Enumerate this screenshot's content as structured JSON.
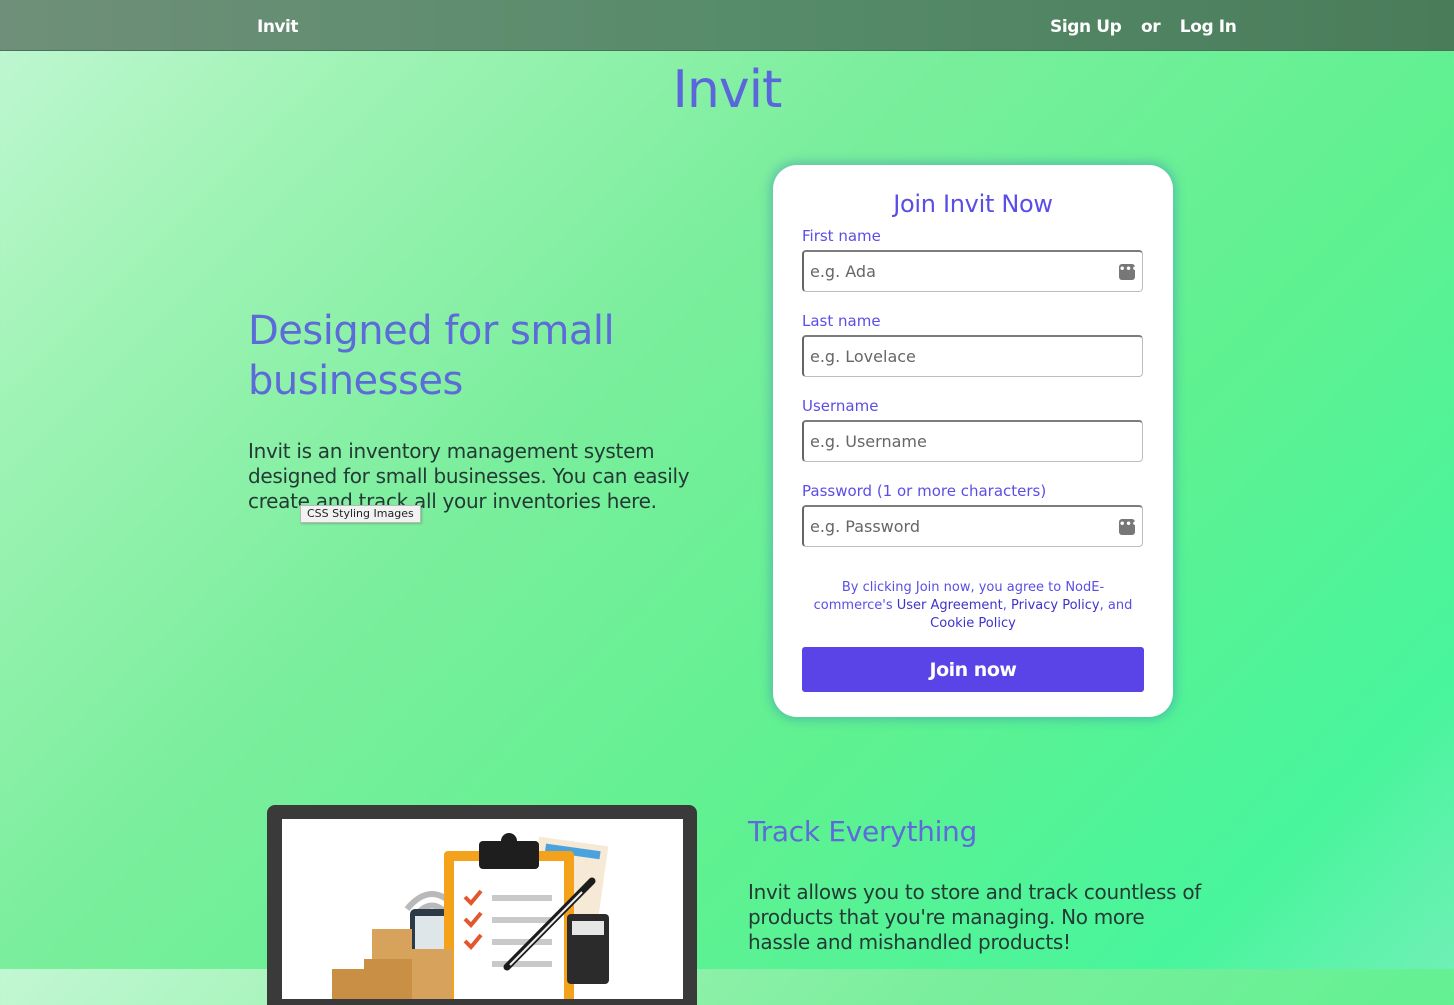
{
  "nav": {
    "brand": "Invit",
    "sign_up": "Sign Up",
    "or": "or",
    "log_in": "Log In"
  },
  "hero": {
    "title": "Invit"
  },
  "intro": {
    "heading": "Designed for small businesses",
    "text": "Invit is an inventory management system designed for small businesses. You can easily create and track all your inventories here.",
    "tooltip": "CSS Styling Images"
  },
  "form": {
    "title": "Join Invit Now",
    "first_name_label": "First name",
    "first_name_placeholder": "e.g. Ada",
    "last_name_label": "Last name",
    "last_name_placeholder": "e.g. Lovelace",
    "username_label": "Username",
    "username_placeholder": "e.g. Username",
    "password_label": "Password (1 or more characters)",
    "password_placeholder": "e.g. Password",
    "terms_prefix": "By clicking Join now, you agree to NodE-commerce's",
    "user_agreement": "User Agreement",
    "privacy_policy": "Privacy Policy",
    "and": "and",
    "cookie_policy": "Cookie Policy",
    "join_button": "Join now"
  },
  "feature": {
    "title": "Track Everything",
    "text": "Invit allows you to store and track countless of products that you're managing. No more hassle and mishandled products!"
  },
  "colors": {
    "accent": "#5b4ee6",
    "heading": "#5d6ad9",
    "button": "#5a44e8"
  },
  "icons": {
    "password_manager": "key-dots-icon"
  }
}
